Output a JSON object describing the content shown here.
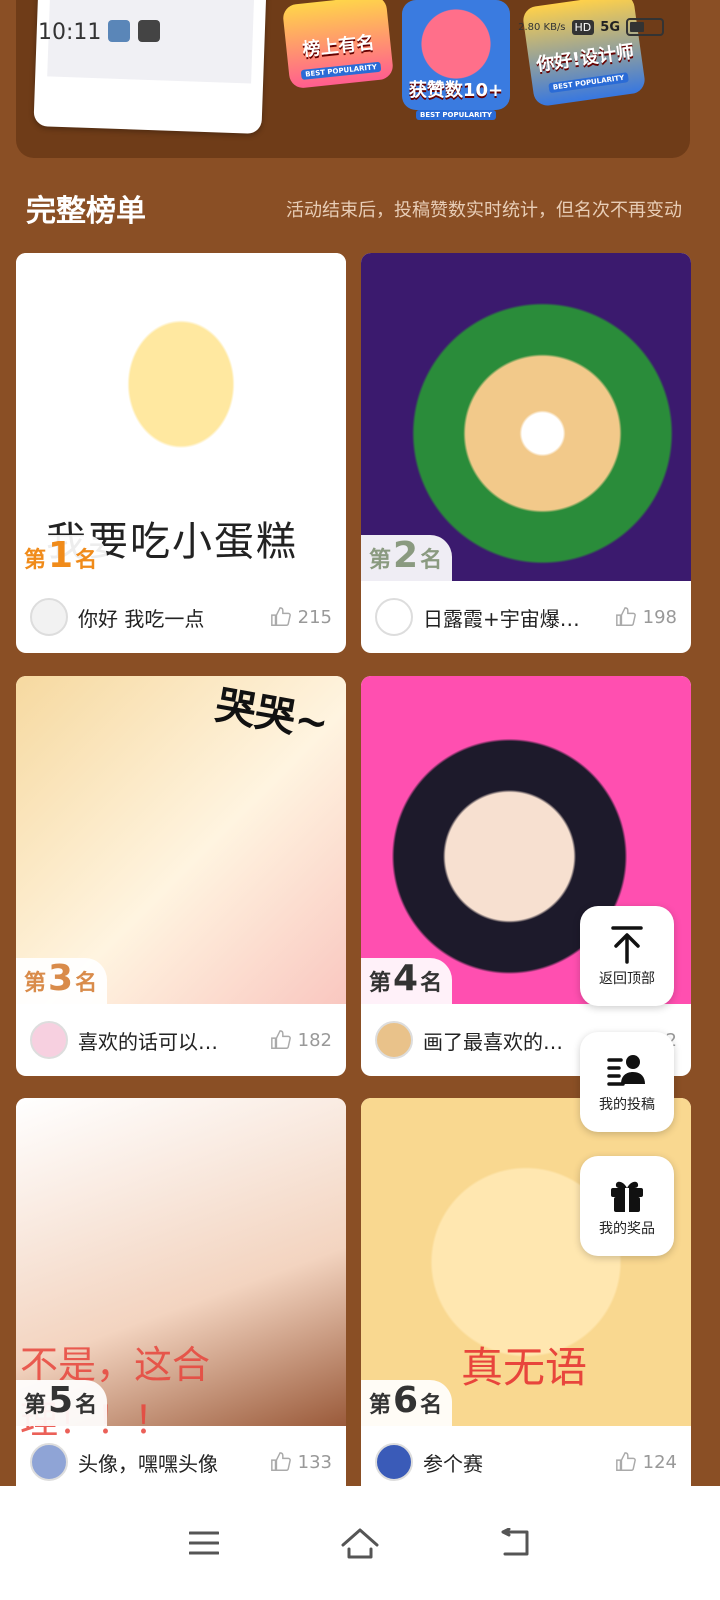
{
  "status_bar": {
    "time": "10:11",
    "net_speed": "2.80 KB/s",
    "hd": "HD",
    "signal": "5G"
  },
  "banner": {
    "badges": [
      {
        "title": "榜上有名",
        "sub": "BEST POPULARITY"
      },
      {
        "title": "获赞数10+",
        "sub": "BEST POPULARITY"
      },
      {
        "title": "你好!设计师",
        "sub": "BEST POPULARITY"
      }
    ]
  },
  "section": {
    "title": "完整榜单",
    "note": "活动结束后，投稿赞数实时统计，但名次不再变动"
  },
  "cards": [
    {
      "rank_prefix": "第",
      "rank": "1",
      "rank_suffix": "名",
      "title": "你好 我吃一点",
      "likes": "215",
      "image_caption": "我要吃小蛋糕"
    },
    {
      "rank_prefix": "第",
      "rank": "2",
      "rank_suffix": "名",
      "title": "日露霞+宇宙爆…",
      "likes": "198"
    },
    {
      "rank_prefix": "第",
      "rank": "3",
      "rank_suffix": "名",
      "title": "喜欢的话可以…",
      "likes": "182",
      "image_caption": "哭哭~"
    },
    {
      "rank_prefix": "第",
      "rank": "4",
      "rank_suffix": "名",
      "title": "画了最喜欢的…",
      "likes": "…2"
    },
    {
      "rank_prefix": "第",
      "rank": "5",
      "rank_suffix": "名",
      "title": "头像，嘿嘿头像",
      "likes": "133",
      "image_caption": "不是，这合理！！！"
    },
    {
      "rank_prefix": "第",
      "rank": "6",
      "rank_suffix": "名",
      "title": "参个赛",
      "likes": "124",
      "image_caption": "真无语"
    }
  ],
  "fabs": {
    "back_top": "返回顶部",
    "my_posts": "我的投稿",
    "my_prizes": "我的奖品"
  },
  "colors": {
    "background": "#8a4f25",
    "banner": "#6f3c18",
    "rank1": "#f08b1a"
  }
}
